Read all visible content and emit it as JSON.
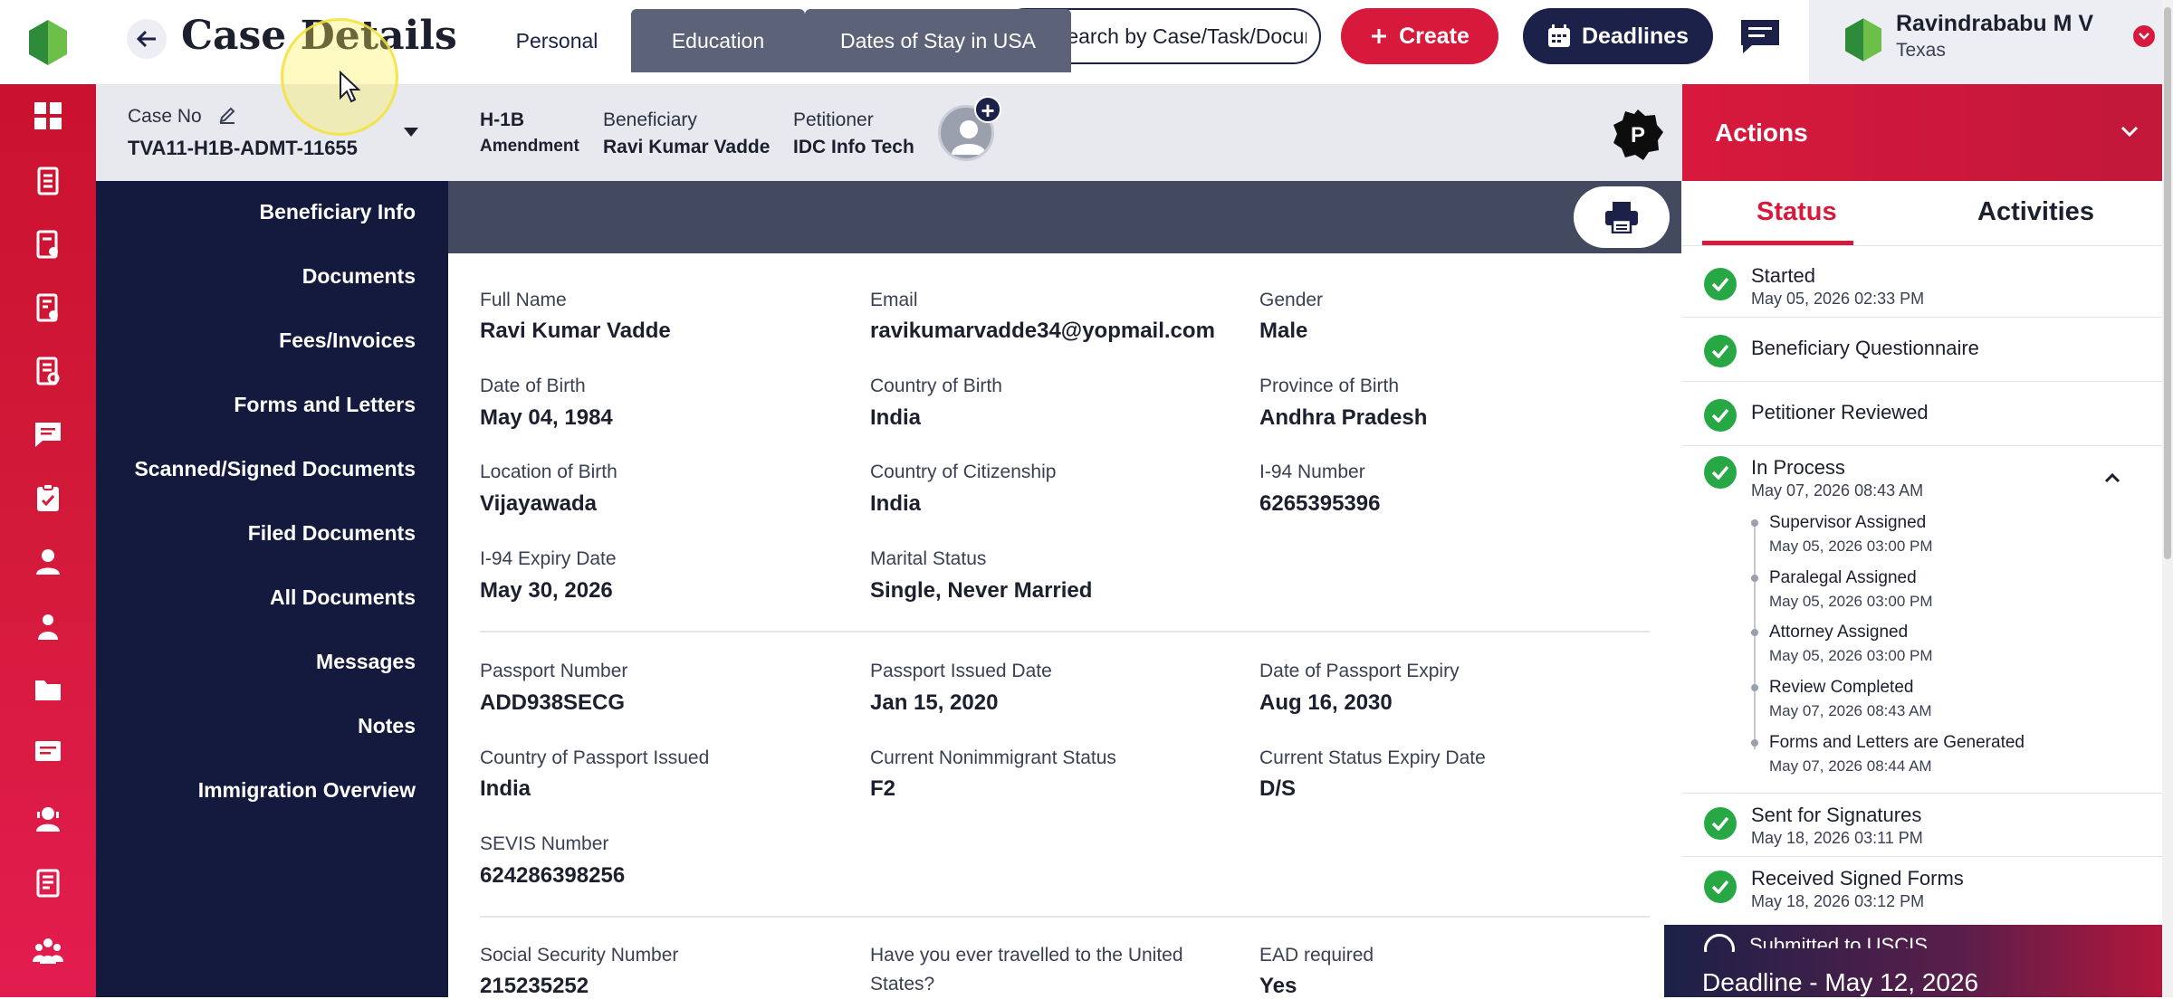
{
  "app": {
    "brand_color": "#2e8b3a",
    "accent": "#d7193c",
    "navy": "#1b2148"
  },
  "header": {
    "title": "Case Details",
    "search_placeholder": "Search by Case/Task/Document",
    "create_label": "Create",
    "deadlines_label": "Deadlines",
    "user_name": "Ravindrababu M V",
    "user_location": "Texas"
  },
  "case": {
    "case_no_label": "Case No",
    "case_no": "TVA11-H1B-ADMT-11655",
    "visa_type": "H-1B",
    "visa_subtype": "Amendment",
    "beneficiary_label": "Beneficiary",
    "beneficiary": "Ravi Kumar Vadde",
    "petitioner_label": "Petitioner",
    "petitioner": "IDC Info Tech",
    "badge_letter": "P"
  },
  "leftnav": {
    "items": [
      "Beneficiary Info",
      "Documents",
      "Fees/Invoices",
      "Forms and Letters",
      "Scanned/Signed Documents",
      "Filed Documents",
      "All Documents",
      "Messages",
      "Notes",
      "Immigration Overview"
    ]
  },
  "tabs": [
    "Personal",
    "Education",
    "Dates of Stay in USA"
  ],
  "personal": {
    "full_name_label": "Full Name",
    "full_name": "Ravi Kumar Vadde",
    "email_label": "Email",
    "email": "ravikumarvadde34@yopmail.com",
    "gender_label": "Gender",
    "gender": "Male",
    "dob_label": "Date of Birth",
    "dob": "May 04, 1984",
    "cob_label": "Country of Birth",
    "cob": "India",
    "pob_label": "Province of Birth",
    "pob": "Andhra Pradesh",
    "lob_label": "Location of Birth",
    "lob": "Vijayawada",
    "coc_label": "Country of Citizenship",
    "coc": "India",
    "i94_label": "I-94 Number",
    "i94": "6265395396",
    "i94exp_label": "I-94 Expiry Date",
    "i94exp": "May 30, 2026",
    "marital_label": "Marital Status",
    "marital": "Single, Never Married",
    "passport_label": "Passport Number",
    "passport": "ADD938SECG",
    "pissued_label": "Passport Issued Date",
    "pissued": "Jan 15, 2020",
    "pexpiry_label": "Date of Passport Expiry",
    "pexpiry": "Aug 16, 2030",
    "pcountry_label": "Country of Passport Issued",
    "pcountry": "India",
    "nonimm_label": "Current Nonimmigrant Status",
    "nonimm": "F2",
    "cse_label": "Current Status Expiry Date",
    "cse": "D/S",
    "sevis_label": "SEVIS Number",
    "sevis": "624286398256",
    "ssn_label": "Social Security Number",
    "ssn": "215235252",
    "travel_label_1": "Have you ever travelled to the United",
    "travel_label_2": "States?",
    "ead_label": "EAD required",
    "ead": "Yes"
  },
  "actions": {
    "title": "Actions",
    "tab_status": "Status",
    "tab_activities": "Activities",
    "statuses": [
      {
        "title": "Started",
        "date": "May 05, 2026 02:33 PM"
      },
      {
        "title": "Beneficiary Questionnaire",
        "date": ""
      },
      {
        "title": "Petitioner Reviewed",
        "date": ""
      },
      {
        "title": "In Process",
        "date": "May 07, 2026 08:43 AM"
      },
      {
        "title": "Sent for Signatures",
        "date": "May 18, 2026 03:11 PM"
      },
      {
        "title": "Received Signed Forms",
        "date": "May 18, 2026 03:12 PM"
      },
      {
        "title": "Submitted to USCIS",
        "date": ""
      }
    ],
    "sub_steps": [
      {
        "title": "Supervisor Assigned",
        "date": "May 05, 2026 03:00 PM"
      },
      {
        "title": "Paralegal Assigned",
        "date": "May 05, 2026 03:00 PM"
      },
      {
        "title": "Attorney Assigned",
        "date": "May 05, 2026 03:00 PM"
      },
      {
        "title": "Review Completed",
        "date": "May 07, 2026 08:43 AM"
      },
      {
        "title": "Forms and Letters are Generated",
        "date": "May 07, 2026 08:44 AM"
      }
    ],
    "deadline_text": "Deadline - May 12, 2026"
  }
}
